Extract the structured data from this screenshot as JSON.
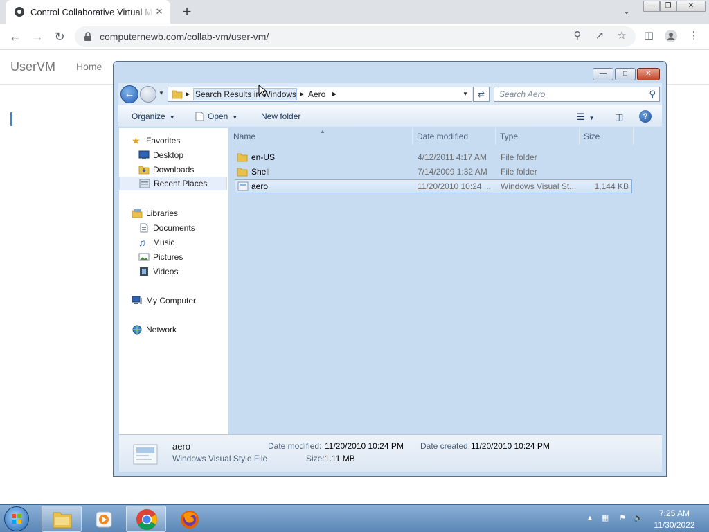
{
  "browser": {
    "tab_title": "Control Collaborative Virtual Machine",
    "url": "computernewb.com/collab-vm/user-vm/",
    "new_tab_symbol": "+",
    "close_symbol": "✕"
  },
  "site": {
    "brand": "UserVM",
    "nav_home": "Home"
  },
  "explorer": {
    "breadcrumb": [
      "Search Results in Windows",
      "Aero"
    ],
    "search_placeholder": "Search Aero",
    "commands": {
      "organize": "Organize",
      "open": "Open",
      "new_folder": "New folder"
    },
    "nav": {
      "favorites": "Favorites",
      "desktop": "Desktop",
      "downloads": "Downloads",
      "recent_places": "Recent Places",
      "libraries": "Libraries",
      "documents": "Documents",
      "music": "Music",
      "pictures": "Pictures",
      "videos": "Videos",
      "my_computer": "My Computer",
      "network": "Network"
    },
    "columns": {
      "name": "Name",
      "date_modified": "Date modified",
      "type": "Type",
      "size": "Size"
    },
    "files": [
      {
        "name": "en-US",
        "date": "4/12/2011 4:17 AM",
        "type": "File folder",
        "size": ""
      },
      {
        "name": "Shell",
        "date": "7/14/2009 1:32 AM",
        "type": "File folder",
        "size": ""
      },
      {
        "name": "aero",
        "date": "11/20/2010 10:24 ...",
        "type": "Windows Visual St...",
        "size": "1,144 KB"
      }
    ],
    "details": {
      "name": "aero",
      "type": "Windows Visual Style File",
      "date_modified_label": "Date modified:",
      "date_modified": "11/20/2010 10:24 PM",
      "size_label": "Size:",
      "size": "1.11 MB",
      "date_created_label": "Date created:",
      "date_created": "11/20/2010 10:24 PM"
    }
  },
  "taskbar": {
    "time": "7:25 AM",
    "date": "11/30/2022"
  }
}
